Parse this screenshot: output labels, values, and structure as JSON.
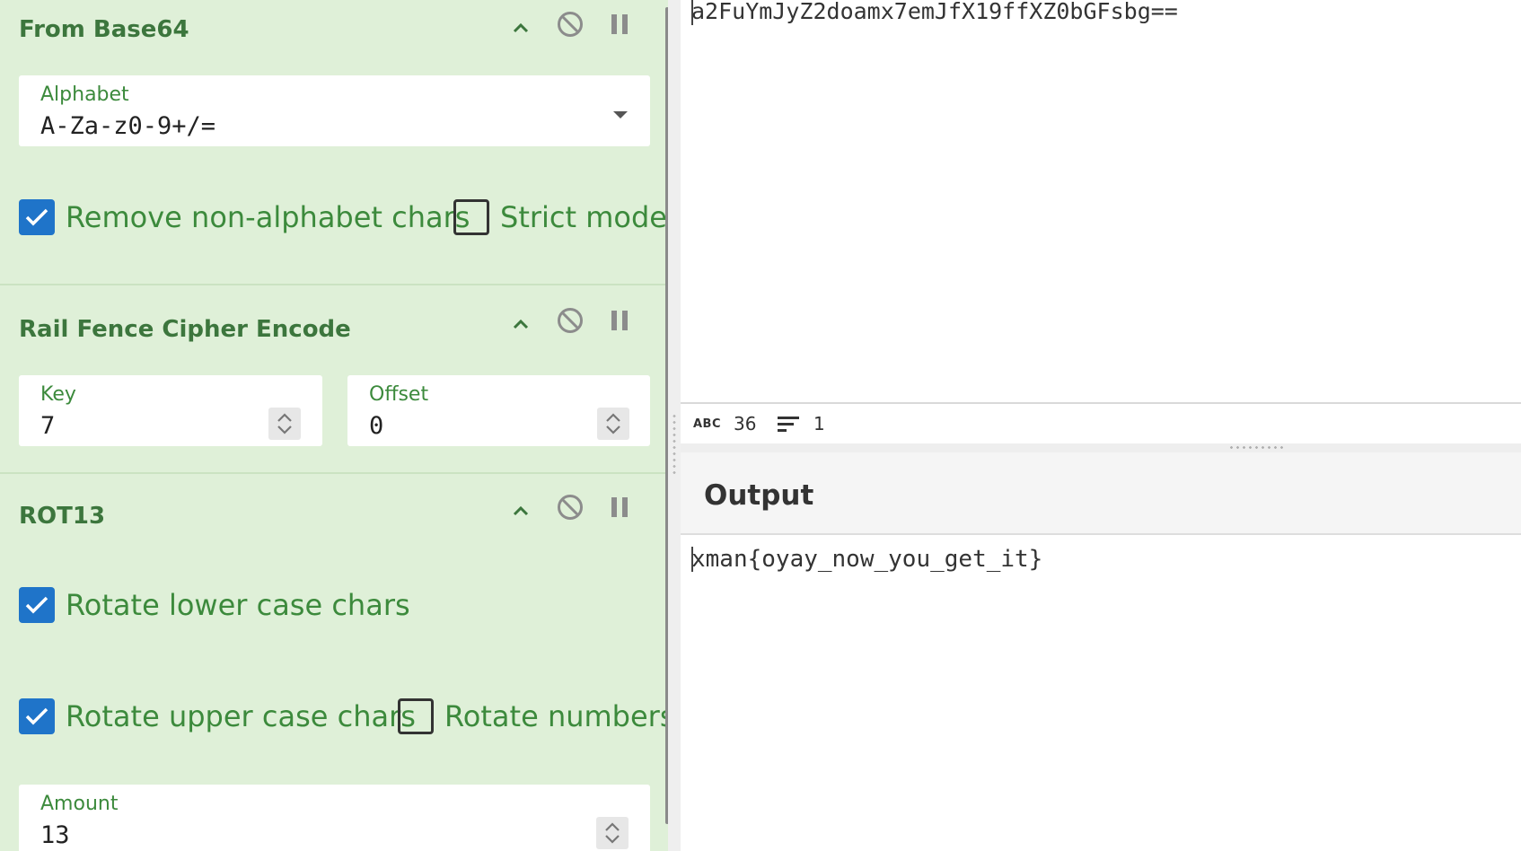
{
  "colors": {
    "recipe_bg": "#dff0d8",
    "title_green": "#3c763d",
    "label_green": "#3c8a3c",
    "checkbox_blue": "#1f74c9",
    "control_grey": "#8c8c8c"
  },
  "operations": [
    {
      "title": "From Base64",
      "controls": [
        "chevron-up-icon",
        "disable-icon",
        "pause-icon"
      ],
      "ingredients": {
        "alphabet": {
          "label": "Alphabet",
          "value": "A-Za-z0-9+/="
        }
      },
      "checkboxes": [
        {
          "label": "Remove non-alphabet chars",
          "checked": true
        },
        {
          "label": "Strict mode",
          "checked": false
        }
      ]
    },
    {
      "title": "Rail Fence Cipher Encode",
      "controls": [
        "chevron-up-icon",
        "disable-icon",
        "pause-icon"
      ],
      "ingredients": {
        "key": {
          "label": "Key",
          "value": "7"
        },
        "offset": {
          "label": "Offset",
          "value": "0"
        }
      }
    },
    {
      "title": "ROT13",
      "controls": [
        "chevron-up-icon",
        "disable-icon",
        "pause-icon"
      ],
      "checkboxes": [
        {
          "label": "Rotate lower case chars",
          "checked": true
        },
        {
          "label": "Rotate upper case chars",
          "checked": true
        },
        {
          "label": "Rotate numbers",
          "checked": false
        }
      ],
      "ingredients": {
        "amount": {
          "label": "Amount",
          "value": "13"
        }
      }
    }
  ],
  "input": {
    "text": "a2FuYmJyZ2doamx7emJfX19ffXZ0bGFsbg==",
    "stats": {
      "length_icon": "abc-icon",
      "length": "36",
      "lines_icon": "lines-icon",
      "lines": "1"
    }
  },
  "output": {
    "title": "Output",
    "text": "xman{oyay_now_you_get_it}"
  }
}
